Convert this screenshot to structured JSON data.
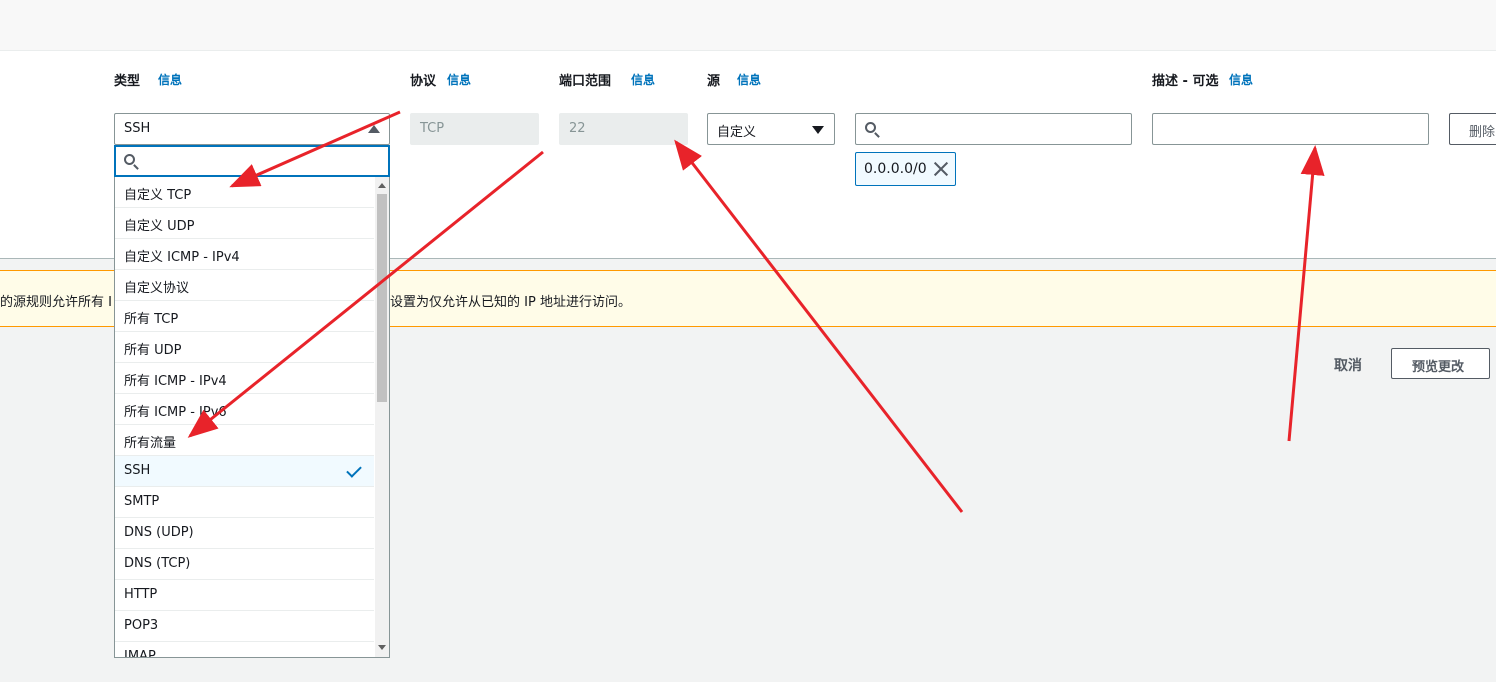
{
  "columns": {
    "type": {
      "label": "类型",
      "info": "信息"
    },
    "protocol": {
      "label": "协议",
      "info": "信息"
    },
    "port_range": {
      "label": "端口范围",
      "info": "信息"
    },
    "source": {
      "label": "源",
      "info": "信息"
    },
    "description": {
      "label": "描述 - 可选",
      "info": "信息"
    }
  },
  "rule": {
    "type_value": "SSH",
    "protocol_value": "TCP",
    "port_value": "22",
    "source_type": "自定义",
    "cidr_token": "0.0.0.0/0",
    "delete_label": "删除"
  },
  "dropdown": {
    "options": [
      "自定义 TCP",
      "自定义 UDP",
      "自定义 ICMP - IPv4",
      "自定义协议",
      "所有 TCP",
      "所有 UDP",
      "所有 ICMP - IPv4",
      "所有 ICMP - IPv6",
      "所有流量",
      "SSH",
      "SMTP",
      "DNS (UDP)",
      "DNS (TCP)",
      "HTTP",
      "POP3",
      "IMAP"
    ],
    "selected": "SSH"
  },
  "warning": {
    "text_left": "的源规则允许所有 I",
    "text_right": "设置为仅允许从已知的 IP 地址进行访问。"
  },
  "footer": {
    "cancel_label": "取消",
    "preview_label": "预览更改"
  },
  "colors": {
    "accent": "#0073bb",
    "annotation": "#e8232a",
    "warning_border": "#ff9900"
  }
}
